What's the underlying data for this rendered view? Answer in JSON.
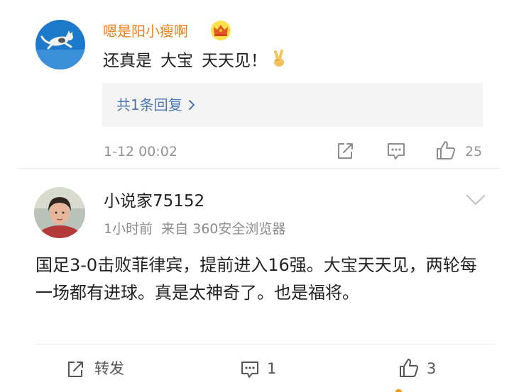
{
  "colors": {
    "vip_name": "#f07f15",
    "link_blue": "#4a77b3",
    "muted_text": "#939393",
    "reply_bg": "#f4f4f4",
    "divider": "#ebebeb",
    "icon_gray": "#8e8e8e"
  },
  "comments": [
    {
      "author": "嗯是阳小瘦啊",
      "badge_icon": "crown-icon",
      "text_parts": [
        "还真是",
        "大宝",
        "天天见！"
      ],
      "emoji_icon": "victory-hand-icon",
      "reply_link": "共1条回复",
      "timestamp": "1-12 00:02",
      "actions": {
        "share_icon": "share-icon",
        "comment_icon": "comment-icon",
        "like_icon": "like-icon",
        "like_count": "25"
      }
    },
    {
      "author": "小说家75152",
      "time": "1小时前",
      "source": "来自 360安全浏览器",
      "menu_icon": "chevron-down-icon",
      "body": "国足3-0击败菲律宾，提前进入16强。大宝天天见，两轮每一场都有进球。真是太神奇了。也是福将。",
      "actions": {
        "share_label": "转发",
        "comment_count": "1",
        "like_count": "3"
      }
    }
  ]
}
